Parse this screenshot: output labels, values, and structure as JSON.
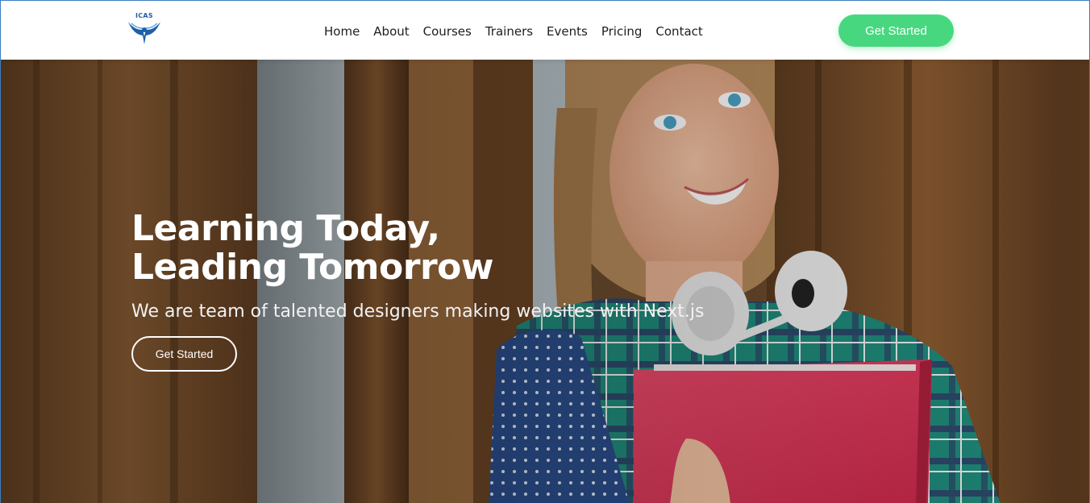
{
  "brand": {
    "logo_text": "ICAS"
  },
  "nav": {
    "items": [
      {
        "label": "Home"
      },
      {
        "label": "About"
      },
      {
        "label": "Courses"
      },
      {
        "label": "Trainers"
      },
      {
        "label": "Events"
      },
      {
        "label": "Pricing"
      },
      {
        "label": "Contact"
      }
    ]
  },
  "header": {
    "cta_label": "Get Started"
  },
  "hero": {
    "title_line1": "Learning Today,",
    "title_line2": "Leading Tomorrow",
    "subtitle": "We are team of talented designers making websites with Next.js",
    "cta_label": "Get Started"
  },
  "colors": {
    "accent": "#47d87f",
    "brand_blue": "#1f5fa6",
    "nav_text": "#1e1e1e"
  }
}
